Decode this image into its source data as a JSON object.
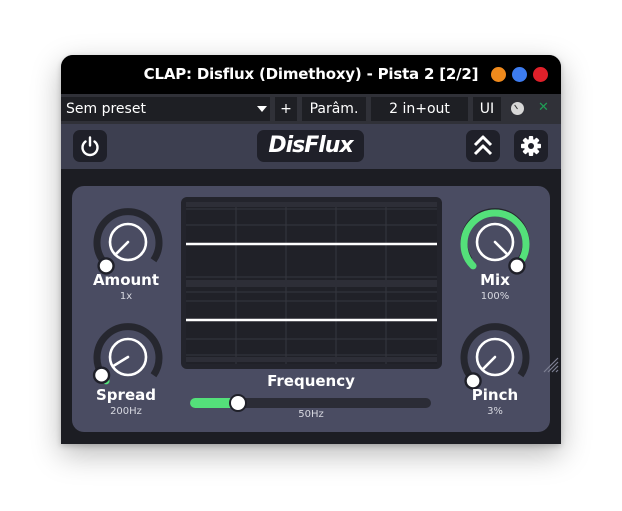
{
  "window": {
    "title": "CLAP: Disflux (Dimethoxy) - Pista 2 [2/2]",
    "buttons": [
      {
        "name": "minimize",
        "color": "#f08a1c"
      },
      {
        "name": "maximize",
        "color": "#3d7cf0"
      },
      {
        "name": "close",
        "color": "#e0202a"
      }
    ]
  },
  "hostbar": {
    "preset": "Sem preset",
    "add_label": "+",
    "params_label": "Parâm.",
    "io_label": "2 in+out",
    "ui_label": "UI"
  },
  "plugin": {
    "logo": "DisFlux",
    "accent_color": "#54e07a",
    "knobs": {
      "amount": {
        "label": "Amount",
        "value": "1x",
        "level": 0.0
      },
      "spread": {
        "label": "Spread",
        "value": "200Hz",
        "level": 0.05
      },
      "mix": {
        "label": "Mix",
        "value": "100%",
        "level": 1.0
      },
      "pinch": {
        "label": "Pinch",
        "value": "3%",
        "level": 0.0
      }
    },
    "frequency": {
      "label": "Frequency",
      "value": "50Hz",
      "level": 0.2
    }
  }
}
